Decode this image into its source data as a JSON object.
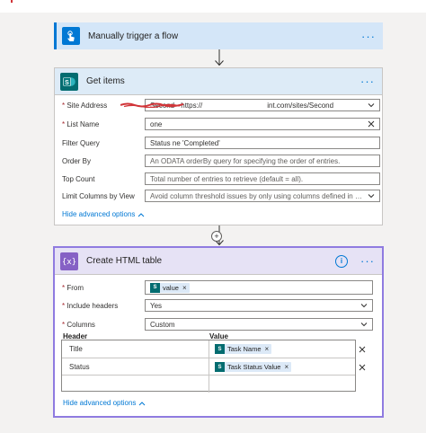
{
  "trigger": {
    "title": "Manually trigger a flow",
    "more": "···"
  },
  "get_items": {
    "title": "Get items",
    "more": "···",
    "fields": {
      "site_address": {
        "label": "Site Address",
        "value": "Second - https://         int.com/sites/Second"
      },
      "list_name": {
        "label": "List Name",
        "value": "one"
      },
      "filter_query": {
        "label": "Filter Query",
        "value": "Status ne 'Completed'"
      },
      "order_by": {
        "label": "Order By",
        "placeholder": "An ODATA orderBy query for specifying the order of entries."
      },
      "top_count": {
        "label": "Top Count",
        "placeholder": "Total number of entries to retrieve (default = all)."
      },
      "limit_columns": {
        "label": "Limit Columns by View",
        "placeholder": "Avoid column threshold issues by only using columns defined in a view"
      }
    },
    "advanced": "Hide advanced options"
  },
  "html_table": {
    "title": "Create HTML table",
    "more": "···",
    "info": "i",
    "from": {
      "label": "From",
      "token": "value"
    },
    "include_headers": {
      "label": "Include headers",
      "value": "Yes"
    },
    "columns": {
      "label": "Columns",
      "value": "Custom"
    },
    "grid_headers": {
      "header": "Header",
      "value": "Value"
    },
    "rows": [
      {
        "header": "Title",
        "token": "Task Name"
      },
      {
        "header": "Status",
        "token": "Task Status Value"
      }
    ],
    "advanced": "Hide advanced options"
  },
  "connector": {
    "plus": "+"
  },
  "icons": {
    "trigger": "touch-hand-icon",
    "sharepoint": "sharepoint-icon",
    "data_operation": "curly-braces-icon"
  },
  "colors": {
    "accent": "#0078d4",
    "sharepoint": "#036c70",
    "data_op": "#8661c5",
    "required": "#a4262c"
  }
}
